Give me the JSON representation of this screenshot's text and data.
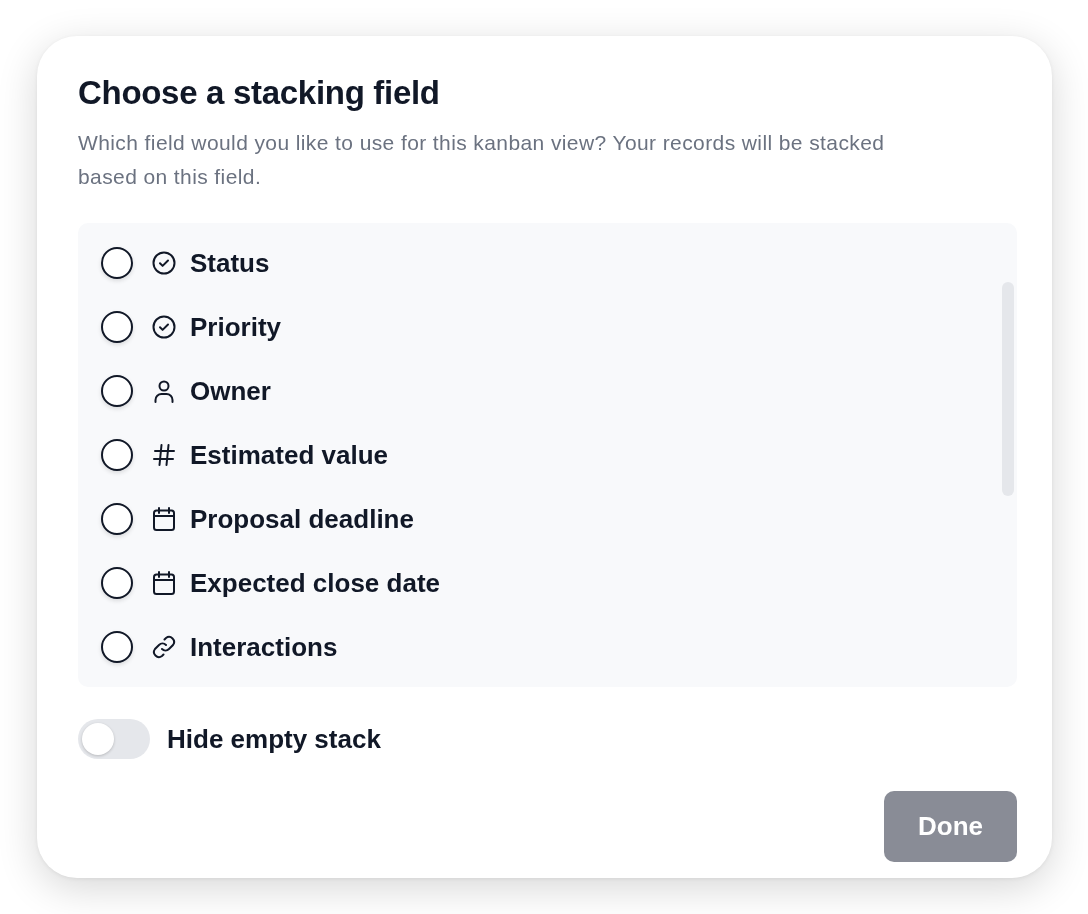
{
  "dialog": {
    "title": "Choose a stacking field",
    "description": "Which field would you like to use for this kanban view? Your records will be stacked based on this field."
  },
  "fields": [
    {
      "label": "Status",
      "kind": "select",
      "selected": false
    },
    {
      "label": "Priority",
      "kind": "select",
      "selected": false
    },
    {
      "label": "Owner",
      "kind": "person",
      "selected": false
    },
    {
      "label": "Estimated value",
      "kind": "number",
      "selected": false
    },
    {
      "label": "Proposal deadline",
      "kind": "date",
      "selected": false
    },
    {
      "label": "Expected close date",
      "kind": "date",
      "selected": false
    },
    {
      "label": "Interactions",
      "kind": "link",
      "selected": false
    }
  ],
  "hide_empty": {
    "label": "Hide empty stack",
    "on": false
  },
  "done_button": {
    "label": "Done",
    "disabled": true
  }
}
